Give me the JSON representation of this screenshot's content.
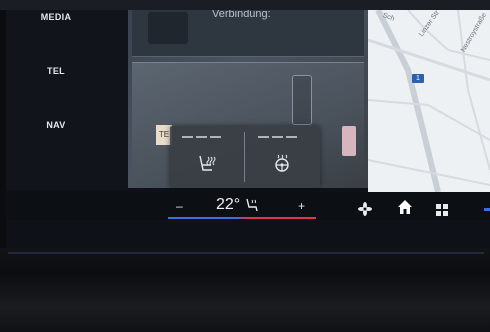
{
  "rail": {
    "items": [
      {
        "label": "MEDIA"
      },
      {
        "label": "TEL"
      },
      {
        "label": "NAV"
      }
    ]
  },
  "panel": {
    "subtitle": "Verbindung:",
    "chip_label": "TE"
  },
  "map": {
    "streets": [
      "Sch",
      "Linzer Str",
      "Nestroystraße"
    ],
    "route_badge": "1"
  },
  "popup": {
    "seat_heating_level": 0,
    "steering_heating_level": 0
  },
  "climate": {
    "minus": "–",
    "temperature": "22°",
    "plus": "+"
  },
  "colors": {
    "accent_blue": "#3b6fe0",
    "accent_red": "#e0364b"
  },
  "icons": [
    "seat-heating-icon",
    "steering-wheel-heating-icon",
    "seat-icon",
    "fan-icon",
    "home-icon",
    "apps-grid-icon"
  ]
}
